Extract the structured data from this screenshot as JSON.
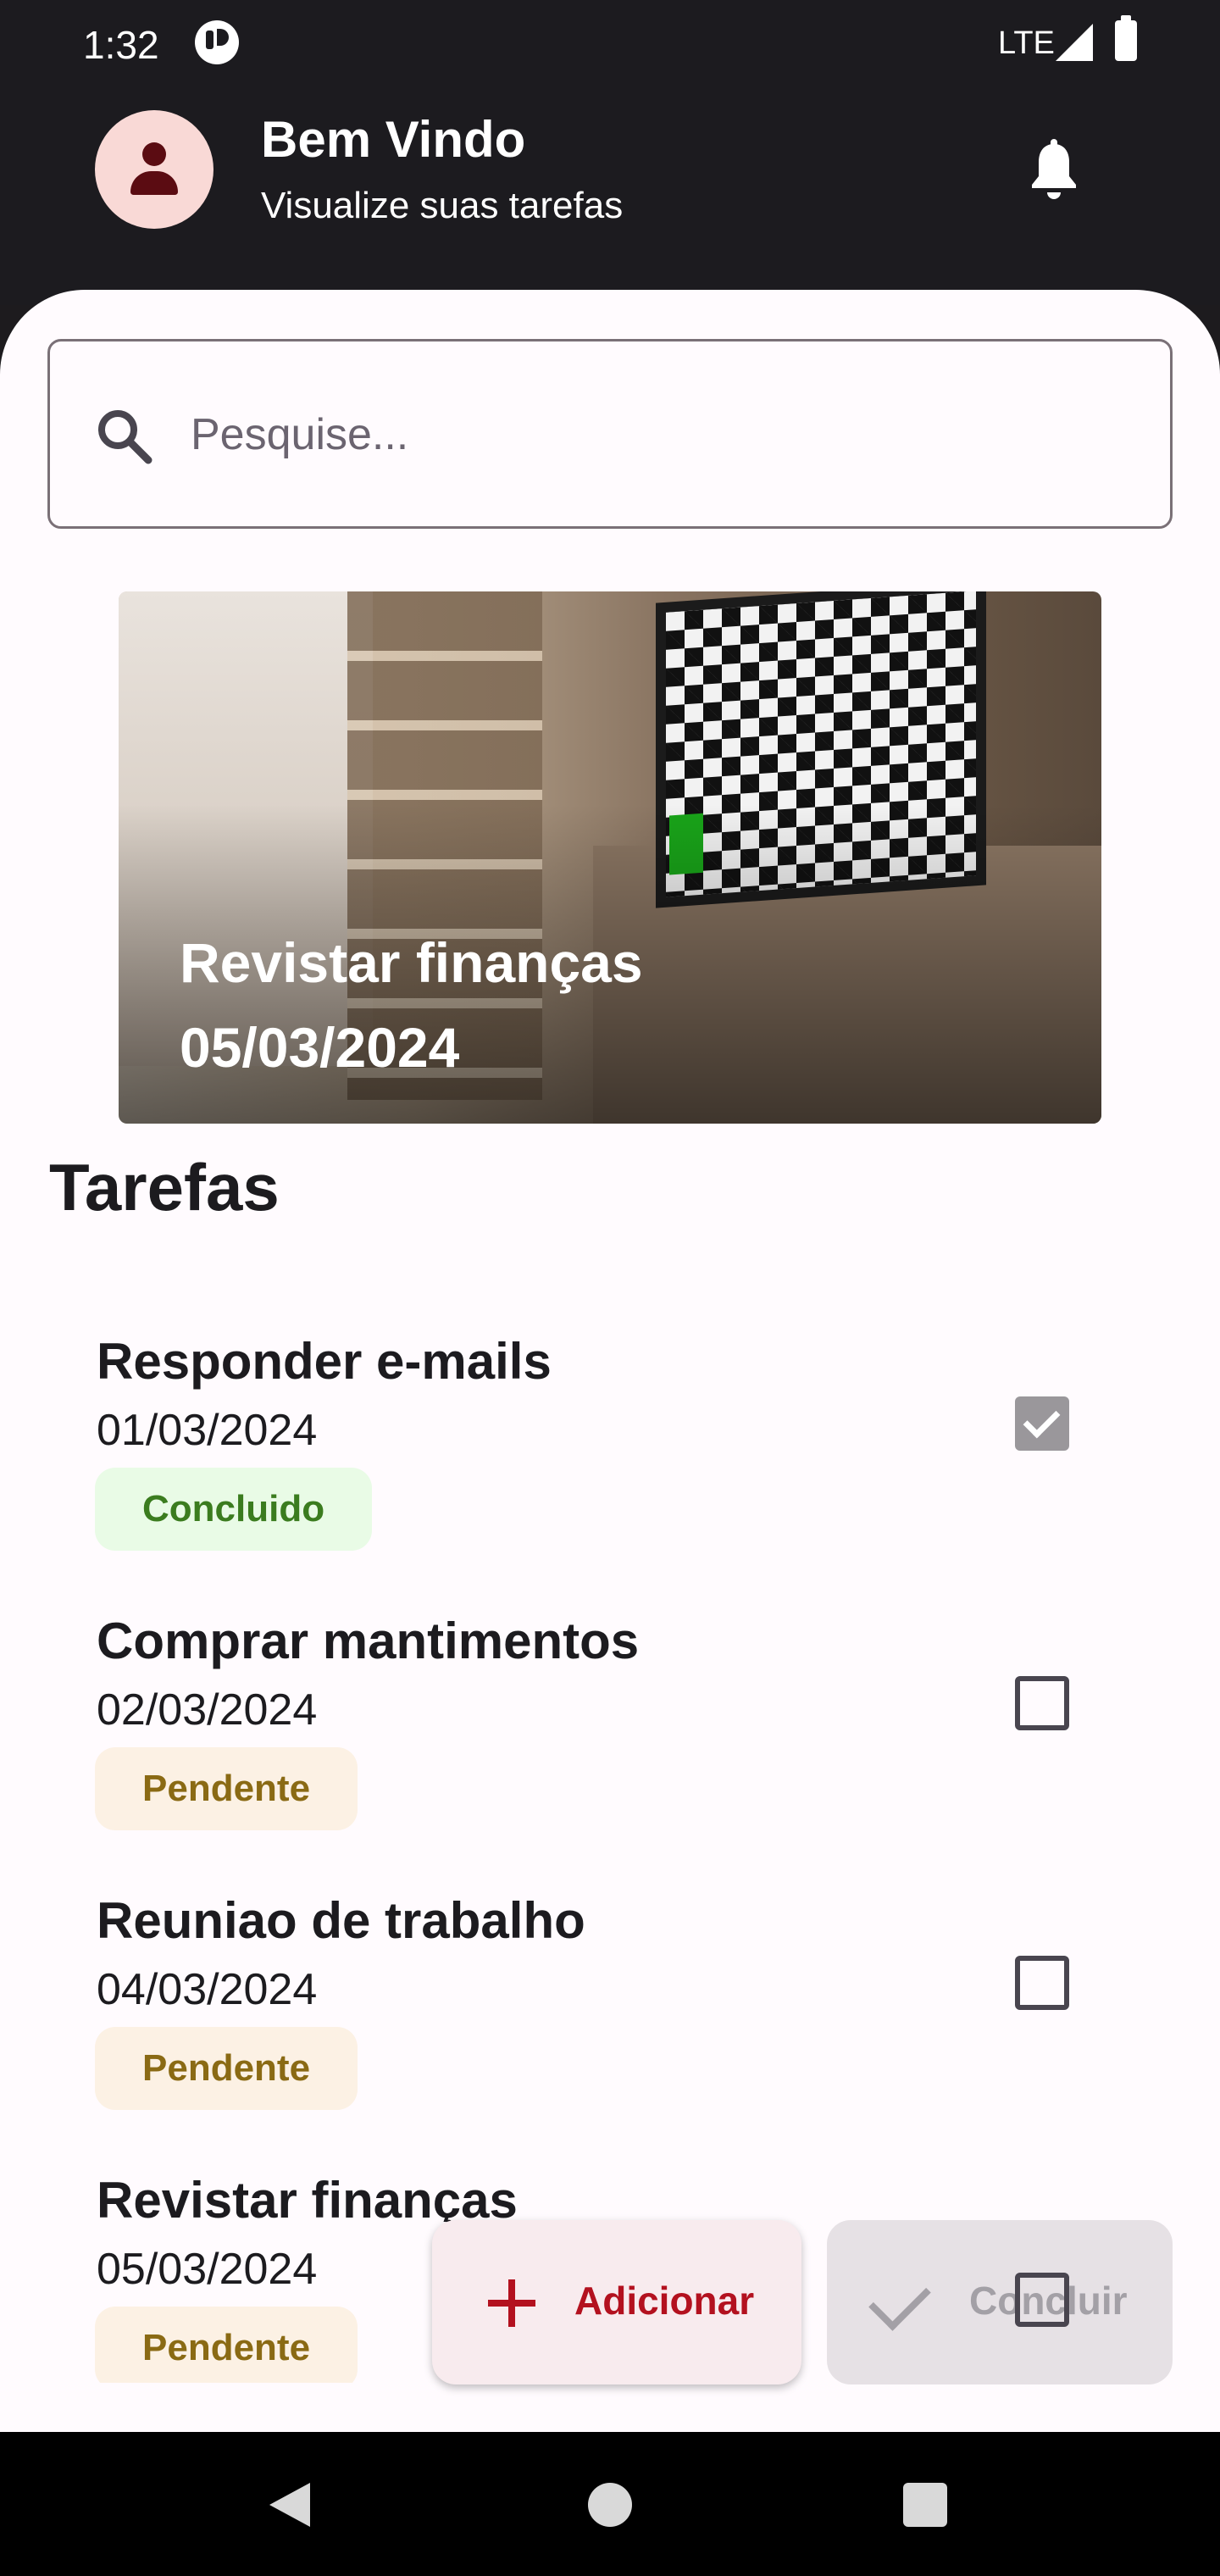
{
  "status_bar": {
    "time": "1:32",
    "network": "LTE"
  },
  "header": {
    "title": "Bem Vindo",
    "subtitle": "Visualize suas tarefas",
    "notification_icon": "bell-icon",
    "avatar_icon": "person-icon"
  },
  "search": {
    "placeholder": "Pesquise...",
    "value": "",
    "icon": "search-icon"
  },
  "banner": {
    "title": "Revistar finanças",
    "date": "05/03/2024"
  },
  "section_title": "Tarefas",
  "tasks": [
    {
      "title": "Responder e-mails",
      "date": "01/03/2024",
      "status": "Concluido",
      "checked": true
    },
    {
      "title": "Comprar mantimentos",
      "date": "02/03/2024",
      "status": "Pendente",
      "checked": false
    },
    {
      "title": "Reuniao de trabalho",
      "date": "04/03/2024",
      "status": "Pendente",
      "checked": false
    },
    {
      "title": "Revistar finanças",
      "date": "05/03/2024",
      "status": "Pendente",
      "checked": false
    }
  ],
  "actions": {
    "add_label": "Adicionar",
    "complete_label": "Concluir"
  },
  "colors": {
    "accent": "#b3111f",
    "done_badge": "#3b7c1f",
    "pending_badge": "#8a6a14",
    "header_bg": "#1c1b1f"
  }
}
